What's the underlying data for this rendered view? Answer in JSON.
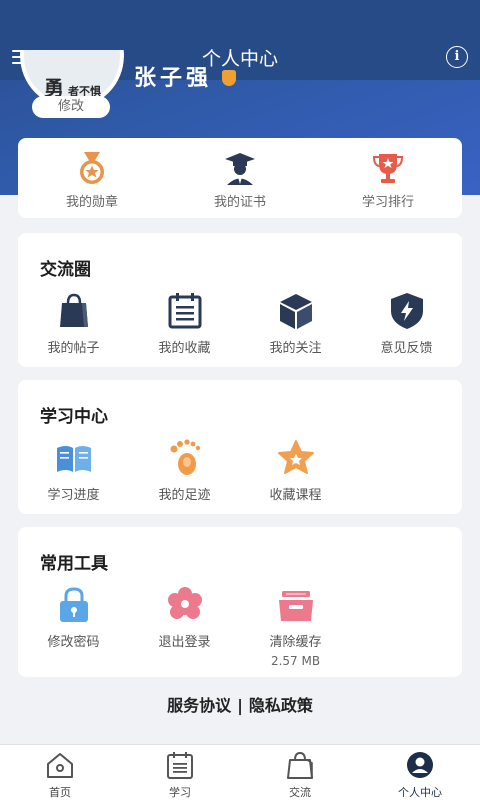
{
  "header": {
    "title": "个人中心",
    "info_glyph": "i"
  },
  "profile": {
    "avatar_text": "勇",
    "avatar_text_small": "者不惧",
    "edit_label": "修改",
    "username": "张子强"
  },
  "top_items": [
    {
      "label": "我的勋章",
      "icon": "medal-icon"
    },
    {
      "label": "我的证书",
      "icon": "graduate-icon"
    },
    {
      "label": "学习排行",
      "icon": "trophy-icon"
    }
  ],
  "community": {
    "title": "交流圈",
    "items": [
      {
        "label": "我的帖子",
        "icon": "bag-icon"
      },
      {
        "label": "我的收藏",
        "icon": "list-icon"
      },
      {
        "label": "我的关注",
        "icon": "cube-icon"
      },
      {
        "label": "意见反馈",
        "icon": "shield-bolt-icon"
      }
    ]
  },
  "study": {
    "title": "学习中心",
    "items": [
      {
        "label": "学习进度",
        "icon": "book-icon"
      },
      {
        "label": "我的足迹",
        "icon": "footprint-icon"
      },
      {
        "label": "收藏课程",
        "icon": "star-icon"
      }
    ]
  },
  "tools": {
    "title": "常用工具",
    "items": [
      {
        "label": "修改密码",
        "icon": "lock-icon"
      },
      {
        "label": "退出登录",
        "icon": "flower-icon"
      },
      {
        "label": "清除缓存",
        "icon": "tray-icon",
        "sub": "2.57 MB"
      }
    ]
  },
  "links": {
    "service": "服务协议",
    "separator": "|",
    "privacy": "隐私政策"
  },
  "tabbar": [
    {
      "label": "首页",
      "icon": "home-icon"
    },
    {
      "label": "学习",
      "icon": "clipboard-icon"
    },
    {
      "label": "交流",
      "icon": "shopping-bag-icon"
    },
    {
      "label": "个人中心",
      "icon": "person-icon",
      "active": true
    }
  ],
  "colors": {
    "primary": "#274b86",
    "medal": "#e8944a",
    "tab_active": "#1c2e4a"
  }
}
